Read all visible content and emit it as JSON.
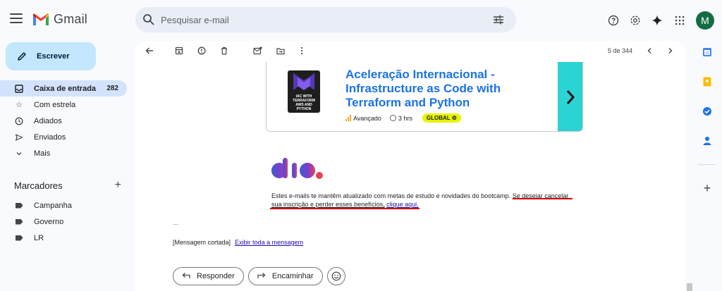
{
  "app": {
    "name": "Gmail"
  },
  "search": {
    "placeholder": "Pesquisar e-mail"
  },
  "user": {
    "initial": "M"
  },
  "compose": {
    "label": "Escrever"
  },
  "nav": [
    {
      "label": "Caixa de entrada",
      "count": "282",
      "icon": "inbox-icon"
    },
    {
      "label": "Com estrela",
      "count": "",
      "icon": "star-icon"
    },
    {
      "label": "Adiados",
      "count": "",
      "icon": "clock-icon"
    },
    {
      "label": "Enviados",
      "count": "",
      "icon": "send-icon"
    },
    {
      "label": "Mais",
      "count": "",
      "icon": "chevron-down-icon"
    }
  ],
  "labels_header": "Marcadores",
  "labels": [
    "Campanha",
    "Governo",
    "LR"
  ],
  "toolbar": {
    "pager": "5 de 344"
  },
  "card": {
    "title": "Aceleração Internacional - Infrastructure as Code with Terraform and Python",
    "thumb_text": "IAC WITH TERRAFORM AWS AND PYTHON",
    "level": "Avançado",
    "duration": "3 hrs",
    "badge": "GLOBAL"
  },
  "email": {
    "body_plain": "Estes e-mails te mantêm atualizado com metas de estudo e novidades do bootcamp.",
    "body_underlined_1": "Se desejar cancelar",
    "body_underlined_2": "sua inscrição e perder esses benefícios,",
    "unsubscribe_link": "clique aqui.",
    "ellipsis": "...",
    "cut_text": "[Mensagem cortada]",
    "cut_link": "Exibir toda a mensagem",
    "reply": "Responder",
    "forward": "Encaminhar"
  },
  "colors": {
    "accent": "#1a73e8",
    "compose_bg": "#c2e7ff",
    "active_nav": "#d3e3fd",
    "card_arrow": "#2bd4d4",
    "annotation": "#d40000"
  }
}
